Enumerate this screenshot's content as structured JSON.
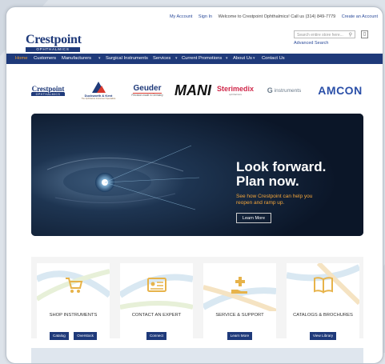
{
  "topbar": {
    "my_account": "My Account",
    "sign_in": "Sign In",
    "welcome": "Welcome to Crestpoint Ophthalmics! Call us (314) 849-7779",
    "create_account": "Create an Account"
  },
  "logo": {
    "name": "Crestpoint",
    "sub": "OPHTHALMICS"
  },
  "search": {
    "placeholder": "Search entire store here...",
    "advanced": "Advanced Search"
  },
  "nav": {
    "items": [
      "Home",
      "Customers",
      "Manufacturers",
      "Surgical Instruments",
      "Services",
      "Current Promotions",
      "About Us",
      "Contact Us"
    ]
  },
  "brands": {
    "crestpoint": "Crestpoint",
    "crestpoint_sub": "OPHTHALMICS",
    "duckworth": "Duckworth & Kent",
    "duckworth_sub": "The Ophthalmic Instrument Specialists",
    "geuder": "Geuder",
    "geuder_sub": "Precision made in Germany",
    "mani": "MANI",
    "sterimedix": "Sterimedix",
    "sterimedix_sub": "ophthalmics",
    "ginstruments": "instruments",
    "amcon": "AMCON"
  },
  "hero": {
    "title_line1": "Look forward.",
    "title_line2": "Plan now.",
    "subtitle": "See how Crestpoint can help you reopen and ramp up.",
    "button": "Learn More"
  },
  "cards": [
    {
      "title": "SHOP INSTRUMENTS",
      "buttons": [
        "Catalog",
        "Overstock"
      ]
    },
    {
      "title": "CONTACT AN EXPERT",
      "buttons": [
        "Connect"
      ]
    },
    {
      "title": "SERVICE & SUPPORT",
      "buttons": [
        "Learn More"
      ]
    },
    {
      "title": "CATALOGS & BROCHURES",
      "buttons": [
        "View Library"
      ]
    }
  ],
  "colors": {
    "navy": "#1f3a7a",
    "orange": "#f0a030",
    "gold": "#e7b34a"
  }
}
